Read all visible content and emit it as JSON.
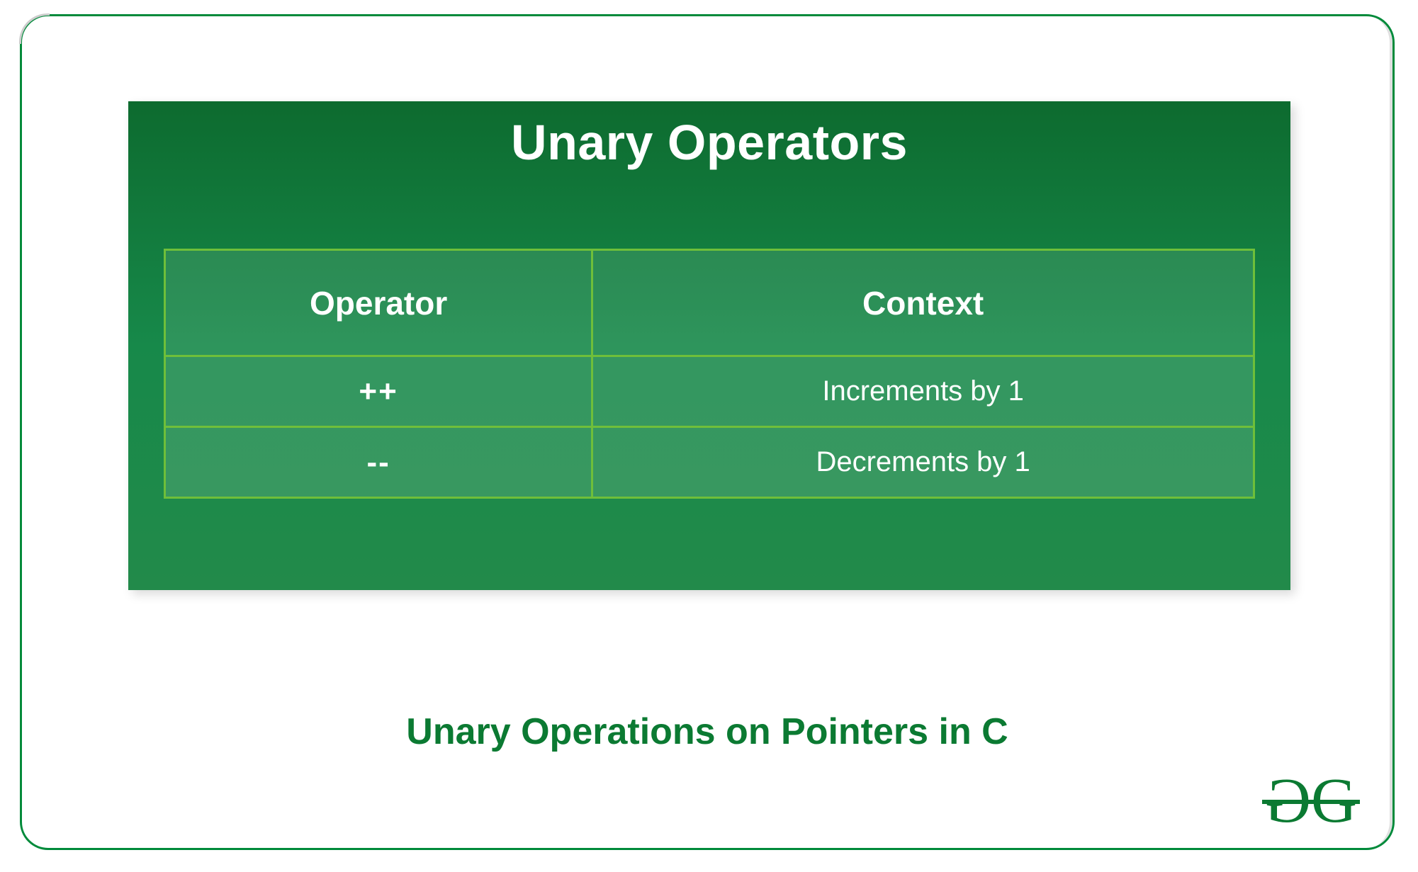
{
  "colors": {
    "accent": "#0b7a32",
    "panel_top": "#0d6b2f",
    "panel_bottom": "#228a4a",
    "table_border": "#6fbf3a"
  },
  "panel": {
    "title": "Unary Operators"
  },
  "table": {
    "headers": {
      "operator": "Operator",
      "context": "Context"
    },
    "rows": [
      {
        "operator": "++",
        "context": "Increments by 1"
      },
      {
        "operator": "--",
        "context": "Decrements by 1"
      }
    ]
  },
  "caption": "Unary Operations on Pointers in C",
  "logo": {
    "name": "geeksforgeeks-logo"
  }
}
